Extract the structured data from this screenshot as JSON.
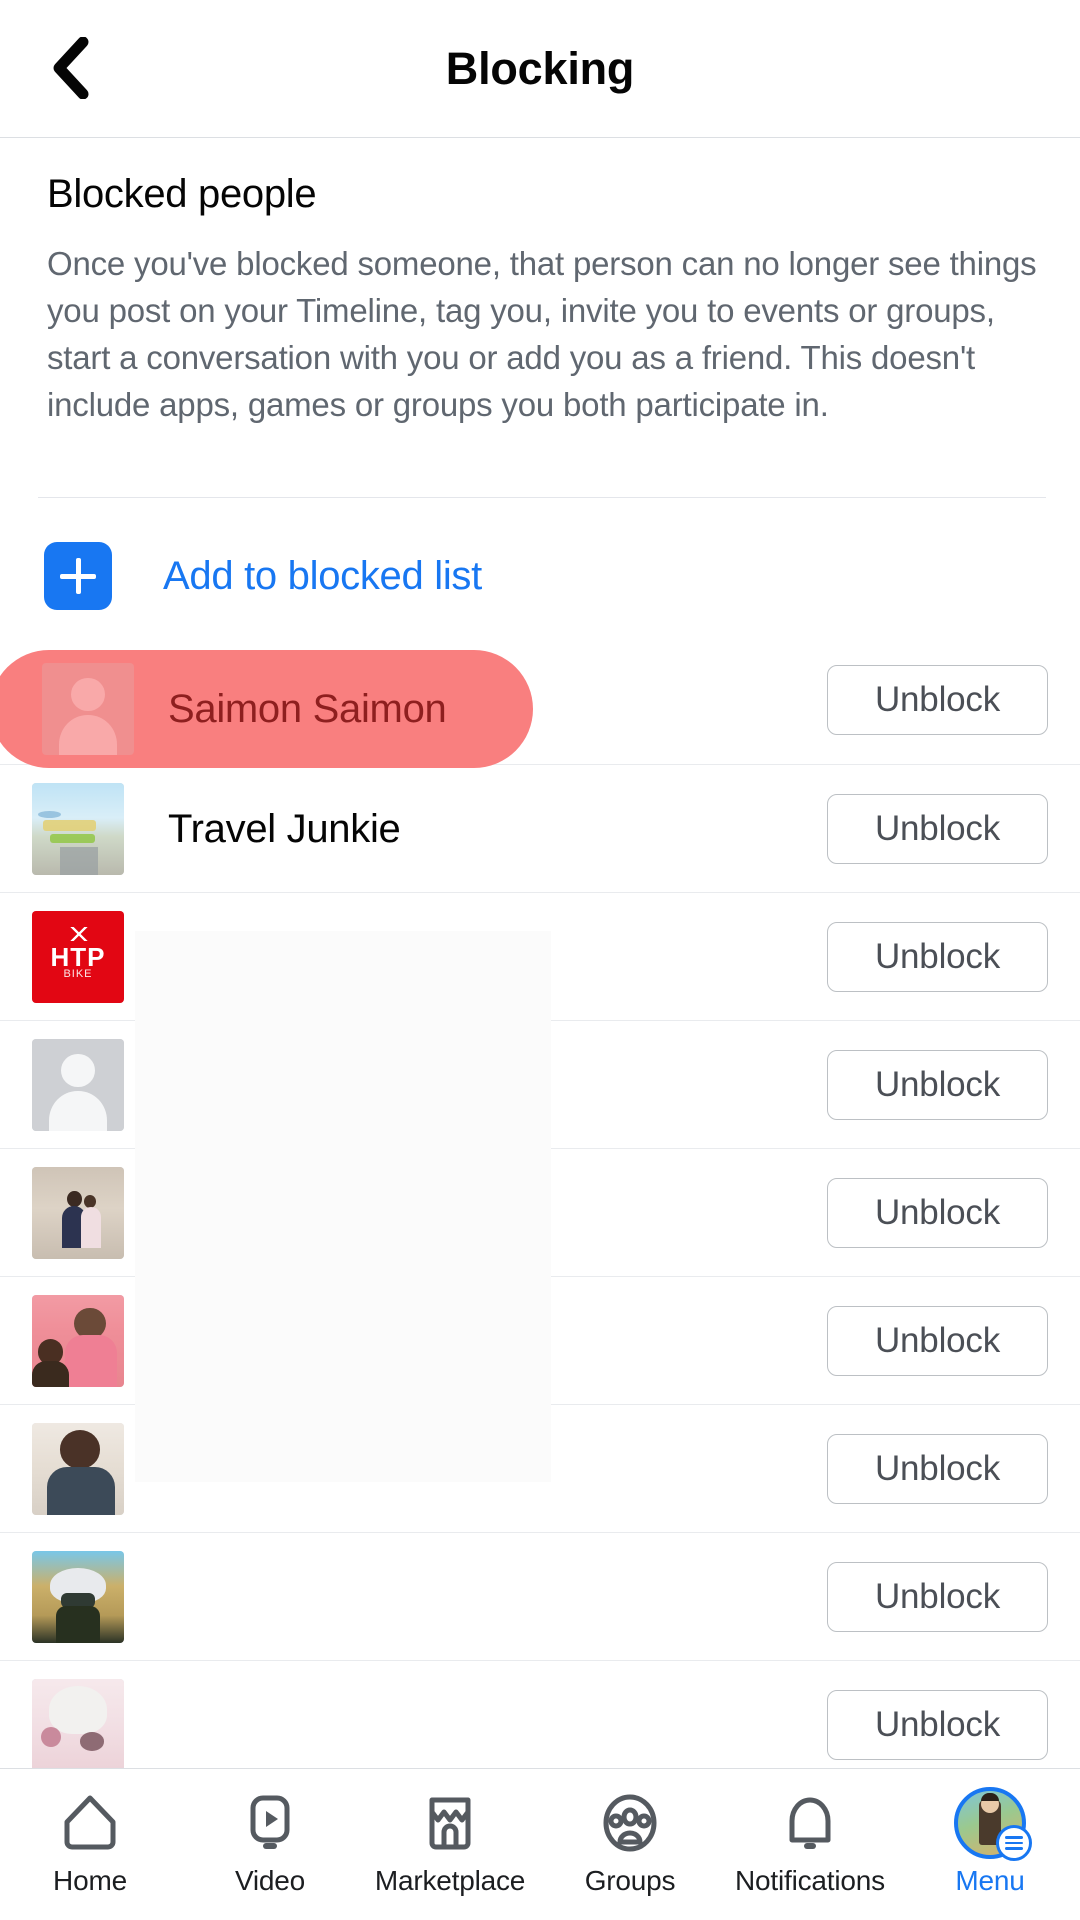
{
  "header": {
    "title": "Blocking",
    "back_icon": "chevron-left-icon"
  },
  "section": {
    "title": "Blocked people",
    "description": "Once you've blocked someone, that person can no longer see things you post on your Timeline, tag you, invite you to events or groups, start a conversation with you or add you as a friend. This doesn't include apps, games or groups you both participate in."
  },
  "add_to_blocked": {
    "label": "Add to blocked list",
    "icon": "plus-icon",
    "accent_color": "#1877f2"
  },
  "highlight": {
    "name": "Saimon Saimon",
    "fill_color": "#f97f7f",
    "text_color": "#8e1f1f"
  },
  "blocked_list": {
    "unblock_label": "Unblock",
    "rows": [
      {
        "name": "Saimon Saimon",
        "avatar": "person-placeholder-avatar",
        "unblock_label": "Unblock"
      },
      {
        "name": "Travel Junkie",
        "avatar": "travel-photo-avatar",
        "unblock_label": "Unblock"
      },
      {
        "name": "",
        "avatar": "htp-logo-avatar",
        "unblock_label": "Unblock"
      },
      {
        "name": "",
        "avatar": "person-placeholder-avatar",
        "unblock_label": "Unblock"
      },
      {
        "name": "",
        "avatar": "family-photo-avatar",
        "unblock_label": "Unblock"
      },
      {
        "name": "",
        "avatar": "couple-photo-avatar",
        "unblock_label": "Unblock"
      },
      {
        "name": "",
        "avatar": "man-photo-avatar",
        "unblock_label": "Unblock"
      },
      {
        "name": "",
        "avatar": "anime-kakashi-avatar",
        "unblock_label": "Unblock"
      },
      {
        "name": "",
        "avatar": "anime-white-hair-avatar",
        "unblock_label": "Unblock"
      }
    ],
    "htp_avatar": {
      "text": "HTP",
      "subtext": "BIKE"
    }
  },
  "bottom_nav": {
    "items": [
      {
        "label": "Home",
        "icon": "home-icon",
        "active": false
      },
      {
        "label": "Video",
        "icon": "video-play-icon",
        "active": false
      },
      {
        "label": "Marketplace",
        "icon": "marketplace-icon",
        "active": false
      },
      {
        "label": "Groups",
        "icon": "groups-icon",
        "active": false
      },
      {
        "label": "Notifications",
        "icon": "bell-icon",
        "active": false
      },
      {
        "label": "Menu",
        "icon": "profile-menu-icon",
        "active": true
      }
    ],
    "active_color": "#1877f2"
  }
}
